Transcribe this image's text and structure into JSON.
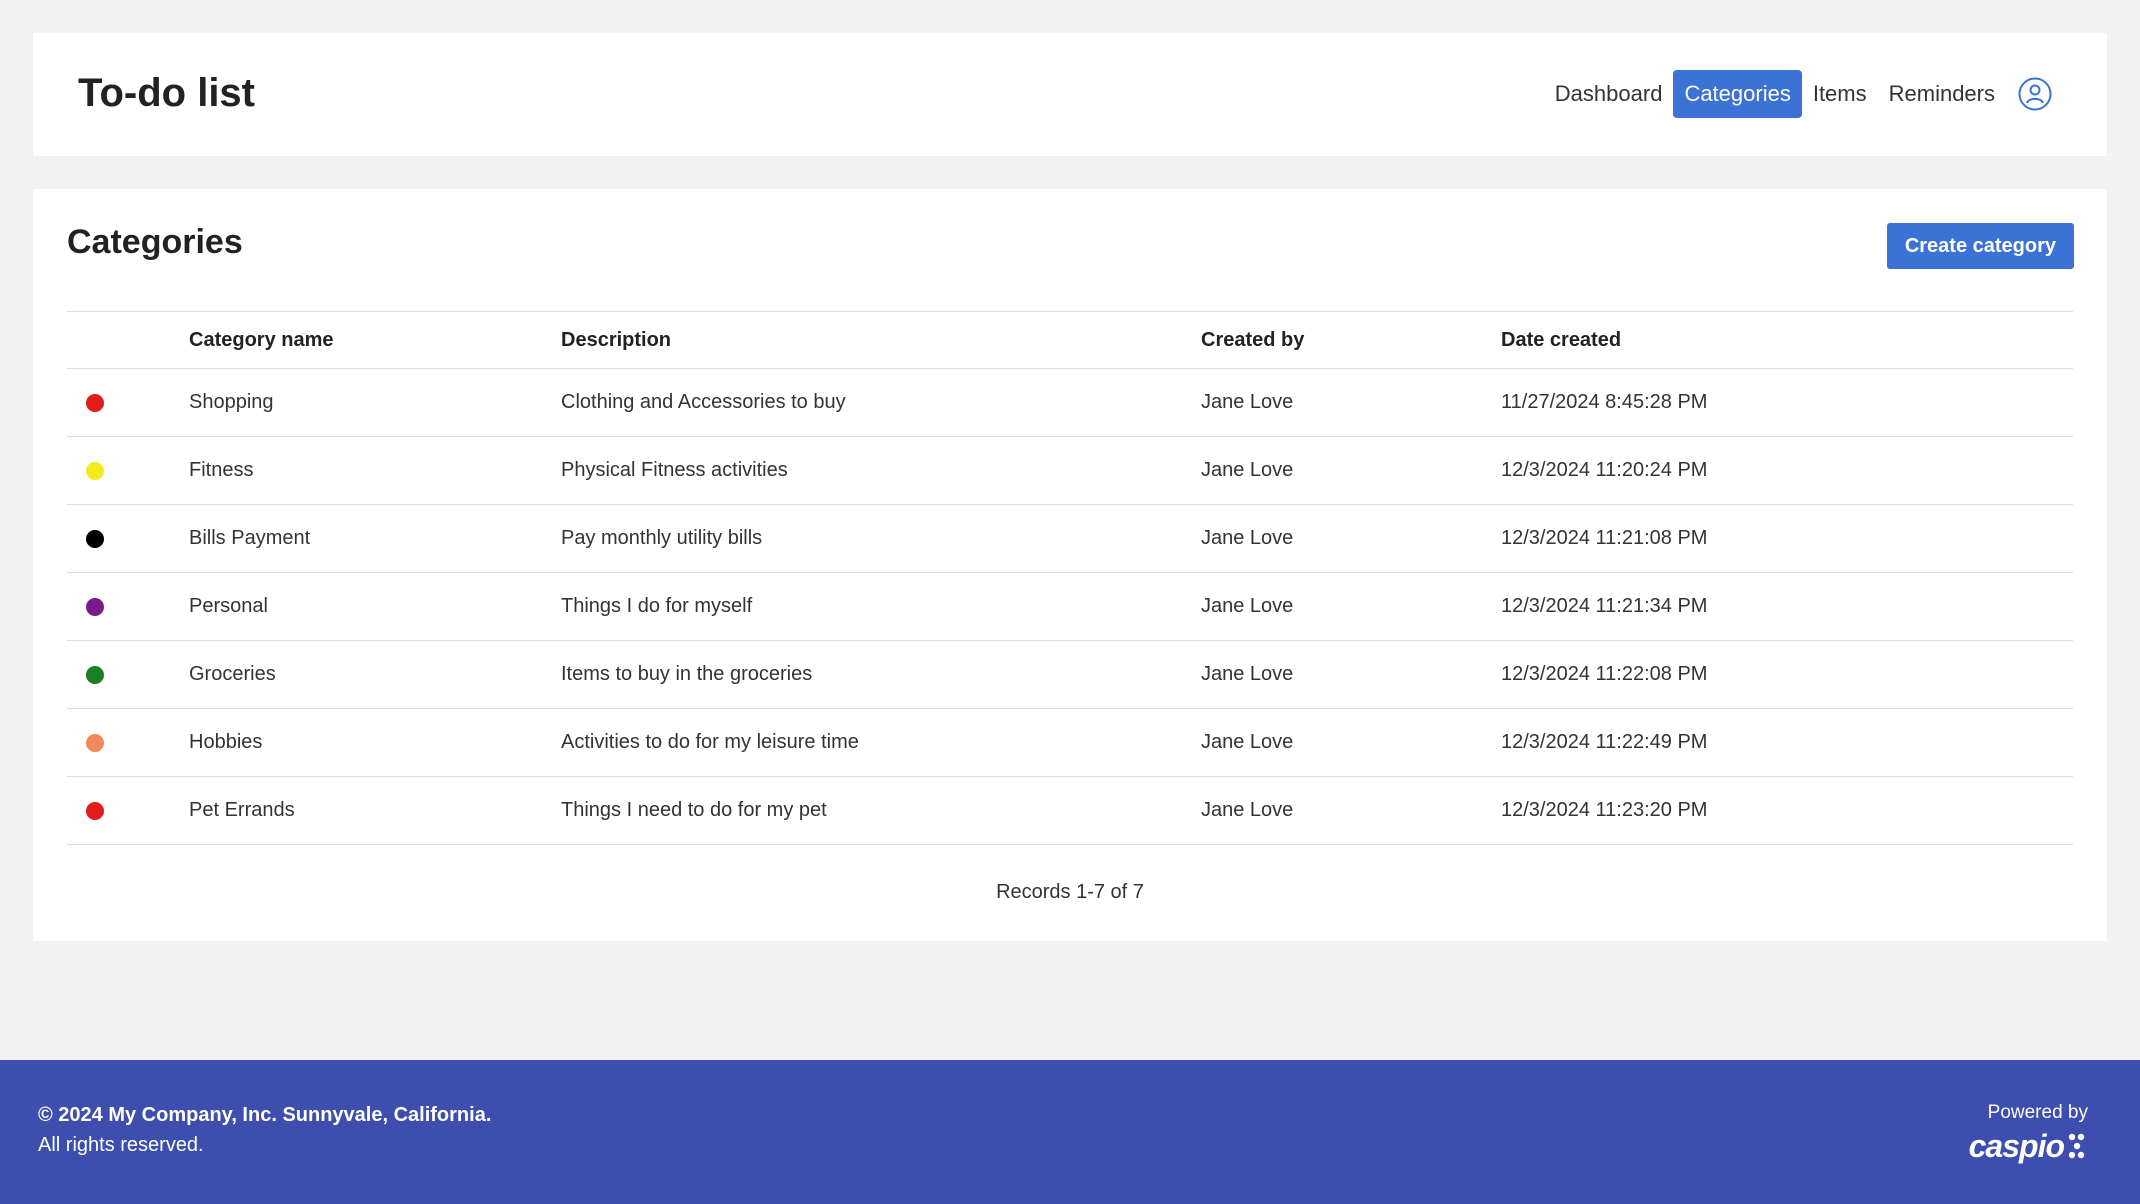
{
  "header": {
    "title": "To-do list",
    "nav": [
      {
        "label": "Dashboard",
        "active": false
      },
      {
        "label": "Categories",
        "active": true
      },
      {
        "label": "Items",
        "active": false
      },
      {
        "label": "Reminders",
        "active": false
      }
    ],
    "user_icon": "user-circle-icon"
  },
  "main": {
    "title": "Categories",
    "create_button": "Create category",
    "columns": [
      "Category name",
      "Description",
      "Created by",
      "Date created"
    ],
    "rows": [
      {
        "color": "#e21b1b",
        "name": "Shopping",
        "description": "Clothing and Accessories to buy",
        "created_by": "Jane Love",
        "date_created": "11/27/2024 8:45:28 PM"
      },
      {
        "color": "#f2ec1f",
        "name": "Fitness",
        "description": "Physical Fitness activities",
        "created_by": "Jane Love",
        "date_created": "12/3/2024 11:20:24 PM"
      },
      {
        "color": "#000000",
        "name": "Bills Payment",
        "description": "Pay monthly utility bills",
        "created_by": "Jane Love",
        "date_created": "12/3/2024 11:21:08 PM"
      },
      {
        "color": "#7b1a8a",
        "name": "Personal",
        "description": "Things I do for myself",
        "created_by": "Jane Love",
        "date_created": "12/3/2024 11:21:34 PM"
      },
      {
        "color": "#1a7f25",
        "name": "Groceries",
        "description": "Items to buy in the groceries",
        "created_by": "Jane Love",
        "date_created": "12/3/2024 11:22:08 PM"
      },
      {
        "color": "#f08a5a",
        "name": "Hobbies",
        "description": "Activities to do for my leisure time",
        "created_by": "Jane Love",
        "date_created": "12/3/2024 11:22:49 PM"
      },
      {
        "color": "#e21b1b",
        "name": "Pet Errands",
        "description": "Things I need to do for my pet",
        "created_by": "Jane Love",
        "date_created": "12/3/2024 11:23:20 PM"
      }
    ],
    "records_text": "Records 1-7 of 7"
  },
  "footer": {
    "copyright": "© 2024 My Company, Inc. Sunnyvale, California.",
    "rights": "All rights reserved.",
    "powered_by": "Powered by",
    "brand": "caspio"
  },
  "colors": {
    "accent": "#3b72d6",
    "footer_bg": "#3d4eae",
    "page_bg": "#f2f2f2"
  }
}
